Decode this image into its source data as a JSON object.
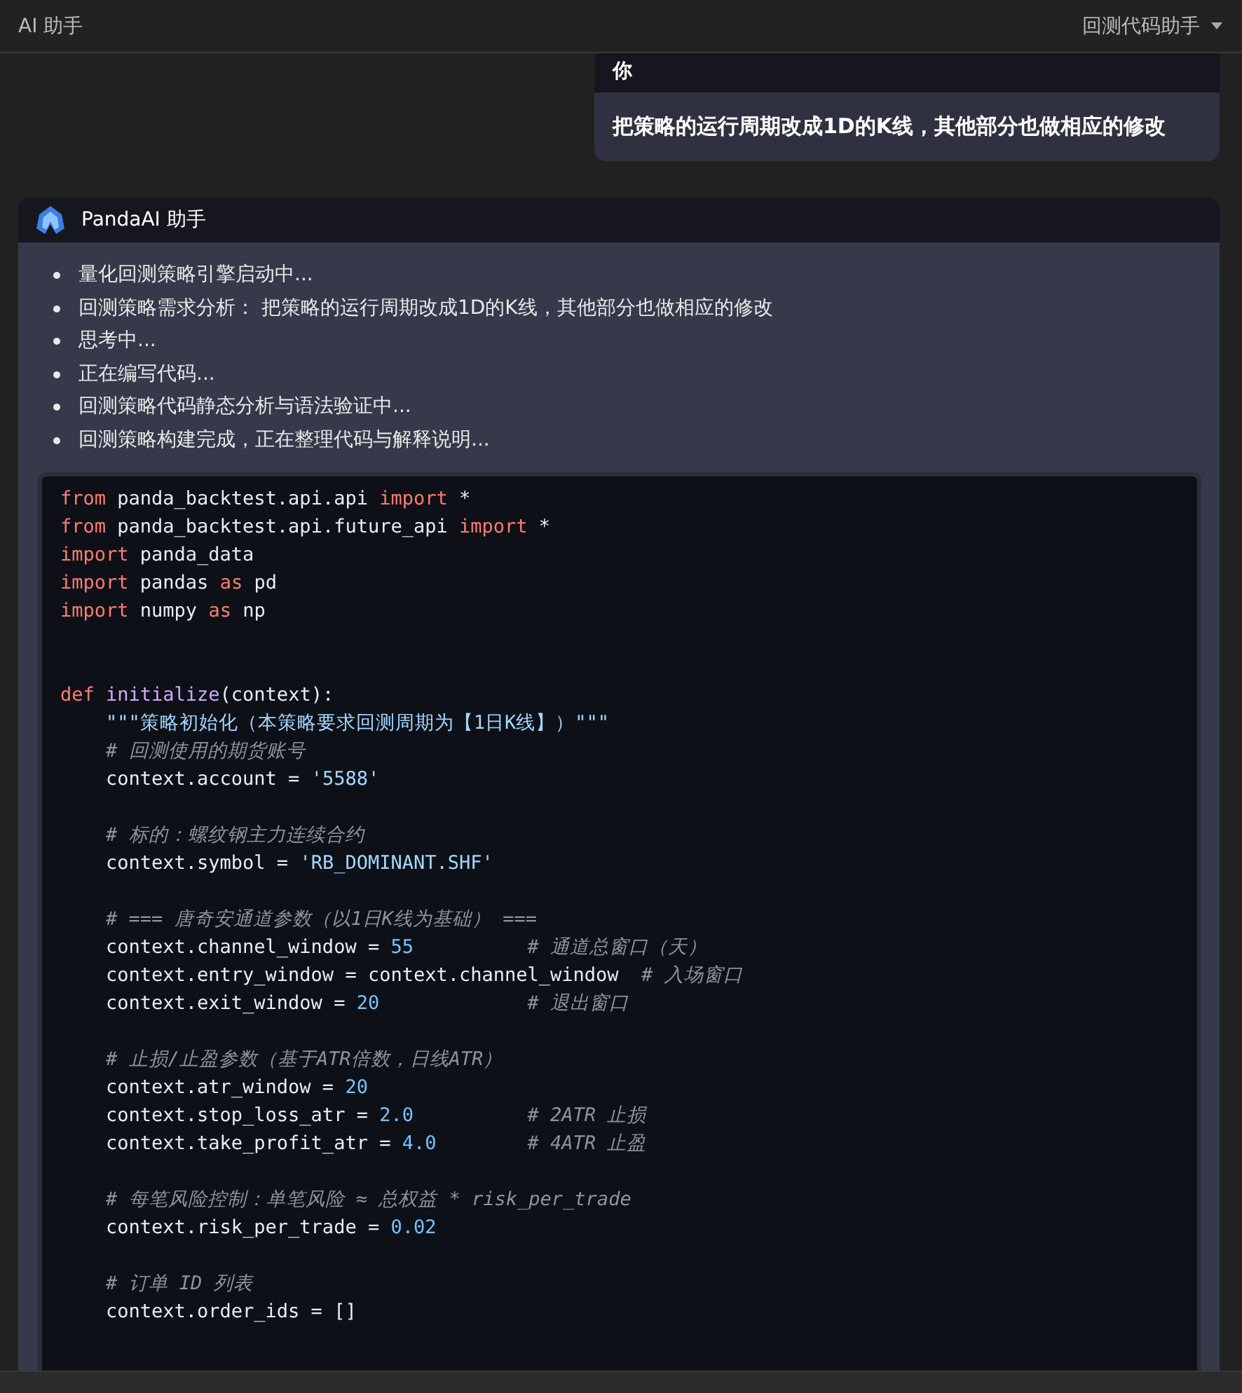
{
  "header": {
    "title": "AI 助手",
    "mode_dropdown": "回测代码助手"
  },
  "user_message": {
    "author": "你",
    "text": "把策略的运行周期改成1D的K线，其他部分也做相应的修改"
  },
  "assistant_message": {
    "author": "PandaAI 助手",
    "steps": [
      "量化回测策略引擎启动中...",
      "回测策略需求分析： 把策略的运行周期改成1D的K线，其他部分也做相应的修改",
      "思考中...",
      "正在编写代码...",
      "回测策略代码静态分析与语法验证中...",
      "回测策略构建完成，正在整理代码与解释说明..."
    ],
    "code_lines": [
      {
        "kind": "code",
        "tokens": [
          {
            "kind": "keyword",
            "text": "from"
          },
          {
            "kind": "plain",
            "text": " panda_backtest.api.api "
          },
          {
            "kind": "keyword",
            "text": "import"
          },
          {
            "kind": "plain",
            "text": " *"
          }
        ]
      },
      {
        "kind": "code",
        "tokens": [
          {
            "kind": "keyword",
            "text": "from"
          },
          {
            "kind": "plain",
            "text": " panda_backtest.api.future_api "
          },
          {
            "kind": "keyword",
            "text": "import"
          },
          {
            "kind": "plain",
            "text": " *"
          }
        ]
      },
      {
        "kind": "code",
        "tokens": [
          {
            "kind": "keyword",
            "text": "import"
          },
          {
            "kind": "plain",
            "text": " panda_data"
          }
        ]
      },
      {
        "kind": "code",
        "tokens": [
          {
            "kind": "keyword",
            "text": "import"
          },
          {
            "kind": "plain",
            "text": " pandas "
          },
          {
            "kind": "keyword",
            "text": "as"
          },
          {
            "kind": "plain",
            "text": " pd"
          }
        ]
      },
      {
        "kind": "code",
        "tokens": [
          {
            "kind": "keyword",
            "text": "import"
          },
          {
            "kind": "plain",
            "text": " numpy "
          },
          {
            "kind": "keyword",
            "text": "as"
          },
          {
            "kind": "plain",
            "text": " np"
          }
        ]
      },
      {
        "kind": "blank"
      },
      {
        "kind": "blank"
      },
      {
        "kind": "code",
        "tokens": [
          {
            "kind": "keyword",
            "text": "def "
          },
          {
            "kind": "function",
            "text": "initialize"
          },
          {
            "kind": "plain",
            "text": "(context):"
          }
        ]
      },
      {
        "kind": "code",
        "tokens": [
          {
            "kind": "string",
            "text": "    \"\"\"策略初始化（本策略要求回测周期为【1日K线】）\"\"\""
          }
        ]
      },
      {
        "kind": "code",
        "tokens": [
          {
            "kind": "comment",
            "text": "    # 回测使用的期货账号"
          }
        ]
      },
      {
        "kind": "code",
        "tokens": [
          {
            "kind": "plain",
            "text": "    context.account = "
          },
          {
            "kind": "string",
            "text": "'5588'"
          }
        ]
      },
      {
        "kind": "blank"
      },
      {
        "kind": "code",
        "tokens": [
          {
            "kind": "comment",
            "text": "    # 标的：螺纹钢主力连续合约"
          }
        ]
      },
      {
        "kind": "code",
        "tokens": [
          {
            "kind": "plain",
            "text": "    context.symbol = "
          },
          {
            "kind": "string",
            "text": "'RB_DOMINANT.SHF'"
          }
        ]
      },
      {
        "kind": "blank"
      },
      {
        "kind": "code",
        "tokens": [
          {
            "kind": "comment",
            "text": "    # === 唐奇安通道参数（以1日K线为基础） ==="
          }
        ]
      },
      {
        "kind": "code",
        "tokens": [
          {
            "kind": "plain",
            "text": "    context.channel_window = "
          },
          {
            "kind": "number",
            "text": "55"
          },
          {
            "kind": "comment",
            "text": "          # 通道总窗口（天）"
          }
        ]
      },
      {
        "kind": "code",
        "tokens": [
          {
            "kind": "plain",
            "text": "    context.entry_window = context.channel_window"
          },
          {
            "kind": "comment",
            "text": "  # 入场窗口"
          }
        ]
      },
      {
        "kind": "code",
        "tokens": [
          {
            "kind": "plain",
            "text": "    context.exit_window = "
          },
          {
            "kind": "number",
            "text": "20"
          },
          {
            "kind": "comment",
            "text": "             # 退出窗口"
          }
        ]
      },
      {
        "kind": "blank"
      },
      {
        "kind": "code",
        "tokens": [
          {
            "kind": "comment",
            "text": "    # 止损/止盈参数（基于ATR倍数，日线ATR）"
          }
        ]
      },
      {
        "kind": "code",
        "tokens": [
          {
            "kind": "plain",
            "text": "    context.atr_window = "
          },
          {
            "kind": "number",
            "text": "20"
          }
        ]
      },
      {
        "kind": "code",
        "tokens": [
          {
            "kind": "plain",
            "text": "    context.stop_loss_atr = "
          },
          {
            "kind": "number",
            "text": "2.0"
          },
          {
            "kind": "comment",
            "text": "          # 2ATR 止损"
          }
        ]
      },
      {
        "kind": "code",
        "tokens": [
          {
            "kind": "plain",
            "text": "    context.take_profit_atr = "
          },
          {
            "kind": "number",
            "text": "4.0"
          },
          {
            "kind": "comment",
            "text": "        # 4ATR 止盈"
          }
        ]
      },
      {
        "kind": "blank"
      },
      {
        "kind": "code",
        "tokens": [
          {
            "kind": "comment",
            "text": "    # 每笔风险控制：单笔风险 ≈ 总权益 * risk_per_trade"
          }
        ]
      },
      {
        "kind": "code",
        "tokens": [
          {
            "kind": "plain",
            "text": "    context.risk_per_trade = "
          },
          {
            "kind": "number",
            "text": "0.02"
          }
        ]
      },
      {
        "kind": "blank"
      },
      {
        "kind": "code",
        "tokens": [
          {
            "kind": "comment",
            "text": "    # 订单 ID 列表"
          }
        ]
      },
      {
        "kind": "code",
        "tokens": [
          {
            "kind": "plain",
            "text": "    context.order_ids = []"
          }
        ]
      }
    ]
  }
}
